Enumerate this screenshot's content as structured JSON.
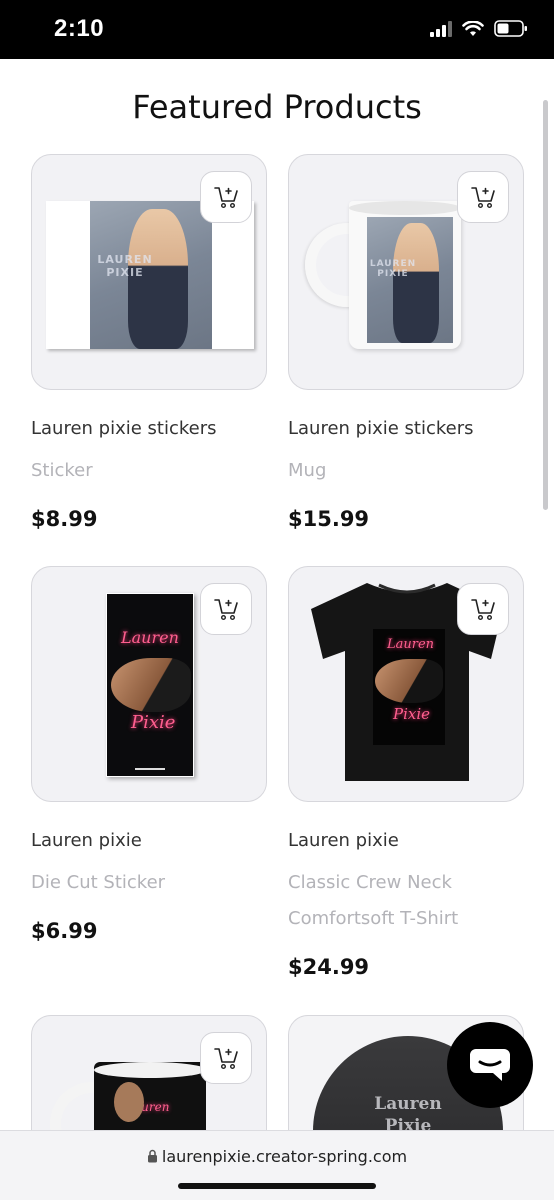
{
  "status_bar": {
    "time": "2:10"
  },
  "page": {
    "title": "Featured Products"
  },
  "products": [
    {
      "name": "Lauren pixie stickers",
      "type": "Sticker",
      "price": "$8.99",
      "image_text": "LAUREN PIXIE"
    },
    {
      "name": "Lauren pixie stickers",
      "type": "Mug",
      "price": "$15.99",
      "image_text": "LAUREN PIXIE"
    },
    {
      "name": "Lauren pixie",
      "type": "Die Cut Sticker",
      "price": "$6.99",
      "image_text_1": "Lauren",
      "image_text_2": "Pixie"
    },
    {
      "name": "Lauren pixie",
      "type": "Classic Crew Neck Comfortsoft T-Shirt",
      "price": "$24.99",
      "image_text_1": "Lauren",
      "image_text_2": "Pixie"
    },
    {
      "image_text": "Lauren"
    },
    {
      "image_text_1": "Lauren",
      "image_text_2": "Pixie"
    }
  ],
  "address_bar": {
    "url": "laurenpixie.creator-spring.com"
  },
  "icons": {
    "cart": "add-to-cart-icon",
    "chat": "chat-icon",
    "lock": "lock-icon"
  },
  "colors": {
    "accent": "#000000",
    "card_bg": "#f2f2f5",
    "muted_text": "#b3b3b8"
  }
}
